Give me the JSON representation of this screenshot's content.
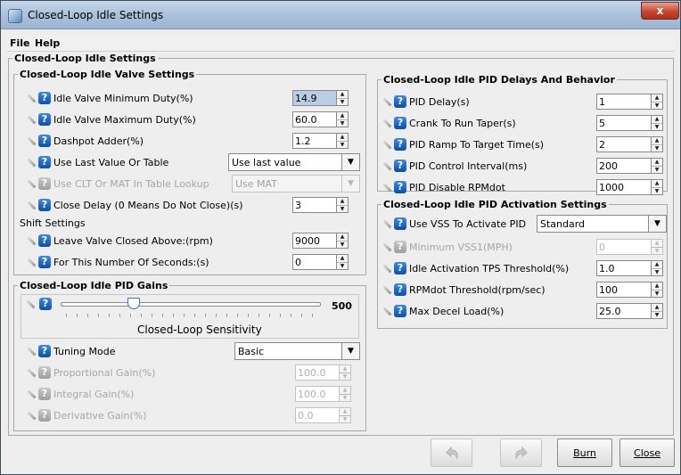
{
  "window": {
    "title": "Closed-Loop Idle Settings",
    "close_glyph": "x"
  },
  "menu": {
    "file": "File",
    "help": "Help"
  },
  "outer_group": {
    "title": "Closed-Loop Idle Settings"
  },
  "valve_settings": {
    "title": "Closed-Loop Idle Valve Settings",
    "idle_min": {
      "label": "Idle Valve Minimum Duty(%)",
      "value": "14.9"
    },
    "idle_max": {
      "label": "Idle Valve Maximum Duty(%)",
      "value": "60.0"
    },
    "dashpot": {
      "label": "Dashpot Adder(%)",
      "value": "1.2"
    },
    "use_last": {
      "label": "Use Last Value Or Table",
      "value": "Use last value"
    },
    "clt_mat": {
      "label": "Use CLT Or MAT In Table Lookup",
      "value": "Use MAT"
    },
    "close_delay": {
      "label": "Close Delay (0 Means Do Not Close)(s)",
      "value": "3"
    },
    "shift_heading": "Shift Settings",
    "leave_closed": {
      "label": "Leave Valve Closed Above:(rpm)",
      "value": "9000"
    },
    "for_seconds": {
      "label": "For This Number Of Seconds:(s)",
      "value": "0"
    }
  },
  "gains": {
    "title": "Closed-Loop Idle PID Gains",
    "slider": {
      "value": "500",
      "label": "Closed-Loop Sensitivity",
      "fraction": 0.28
    },
    "tuning_mode": {
      "label": "Tuning Mode",
      "value": "Basic"
    },
    "proportional": {
      "label": "Proportional Gain(%)",
      "value": "100.0"
    },
    "integral": {
      "label": "Integral Gain(%)",
      "value": "100.0"
    },
    "derivative": {
      "label": "Derivative Gain(%)",
      "value": "0.0"
    }
  },
  "pid_delays": {
    "title": "Closed-Loop Idle PID Delays And Behavior",
    "pid_delay": {
      "label": "PID Delay(s)",
      "value": "1"
    },
    "crank_taper": {
      "label": "Crank To Run Taper(s)",
      "value": "5"
    },
    "ramp_time": {
      "label": "PID Ramp To Target Time(s)",
      "value": "2"
    },
    "control_interval": {
      "label": "PID Control Interval(ms)",
      "value": "200"
    },
    "disable_rpmdot": {
      "label": "PID Disable RPMdot",
      "value": "1000"
    }
  },
  "activation": {
    "title": "Closed-Loop Idle PID Activation Settings",
    "use_vss": {
      "label": "Use VSS To Activate PID",
      "value": "Standard"
    },
    "min_vss": {
      "label": "Minimum VSS1(MPH)",
      "value": "0"
    },
    "tps_threshold": {
      "label": "Idle Activation TPS Threshold(%)",
      "value": "1.0"
    },
    "rpmdot_threshold": {
      "label": "RPMdot Threshold(rpm/sec)",
      "value": "100"
    },
    "max_decel": {
      "label": "Max Decel Load(%)",
      "value": "25.0"
    }
  },
  "buttons": {
    "burn": "Burn",
    "close": "Close"
  },
  "icons": {
    "help": "?",
    "spin_up": "▲",
    "spin_down": "▼",
    "dropdown": "▼"
  }
}
